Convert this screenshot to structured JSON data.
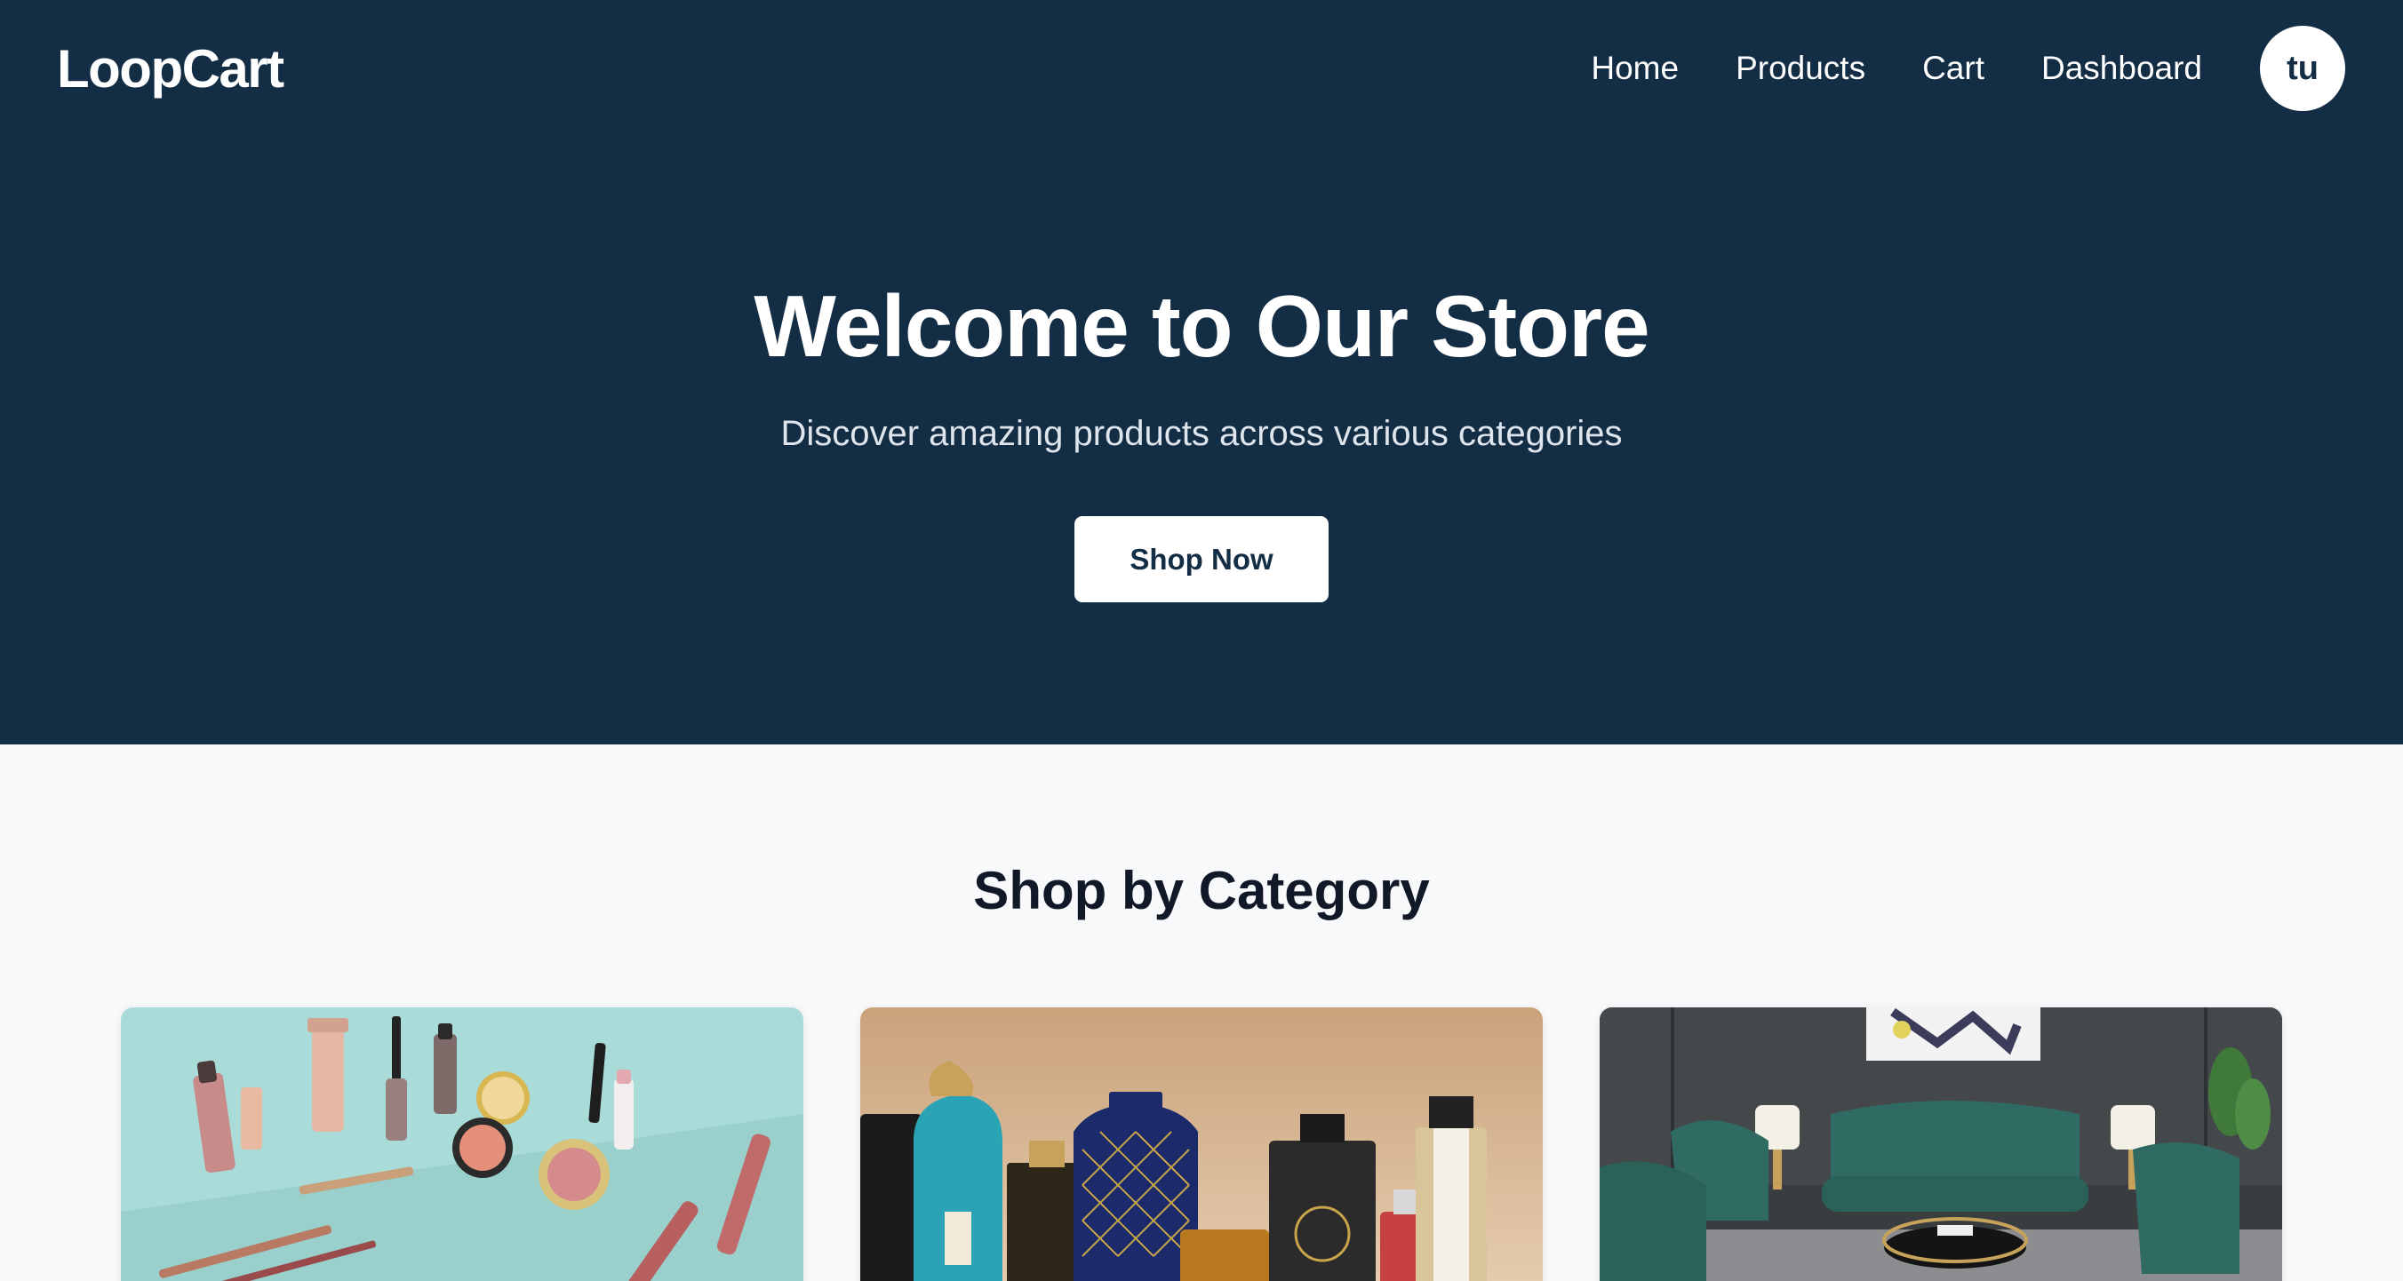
{
  "brand": {
    "name": "LoopCart"
  },
  "nav": {
    "links": [
      {
        "label": "Home"
      },
      {
        "label": "Products"
      },
      {
        "label": "Cart"
      },
      {
        "label": "Dashboard"
      }
    ],
    "avatar_initials": "tu"
  },
  "hero": {
    "title": "Welcome to Our Store",
    "subtitle": "Discover amazing products across various categories",
    "cta_label": "Shop Now"
  },
  "categories_section": {
    "title": "Shop by Category",
    "cards": [
      {
        "image": "makeup-cosmetics-photo"
      },
      {
        "image": "perfume-bottles-photo"
      },
      {
        "image": "green-sofa-living-room-photo"
      }
    ]
  },
  "colors": {
    "hero_bg": "#132d45",
    "page_bg": "#f8f9fb",
    "heading_text": "#111827"
  }
}
